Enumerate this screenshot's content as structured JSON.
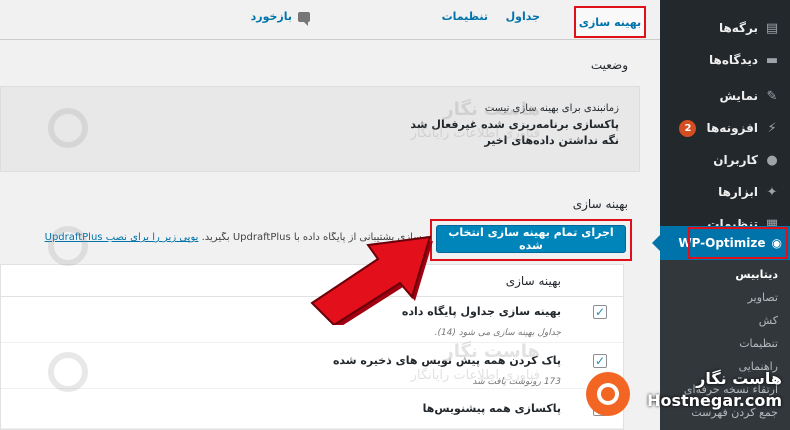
{
  "tabs": {
    "optimize": "بهینه سازی",
    "tables": "جداول",
    "settings": "تنظیمات",
    "feedback": "بازخورد"
  },
  "status": {
    "heading": "وضعیت",
    "lines": [
      "زمانبندی برای بهینه سازی نیست",
      "پاکسازی برنامه‌ریزی شده غیرفعال شد",
      "نگه نداشتن داده‌های اخیر"
    ]
  },
  "optimizations": {
    "heading": "بهینه سازی",
    "hint_text": "ه سازی پشتیبانی از پایگاه داده با UpdraftPlus بگیرید.",
    "hint_link": "یوپی زیر را برای نصب UpdraftPlus",
    "run_all_button": "اجرای تمام بهینه سازی انتخاب شده",
    "table_header": "بهینه سازی",
    "rows": [
      {
        "title": "بهینه سازی جداول پایگاه داده",
        "sub": "جداول بهینه سازی می شود (14)."
      },
      {
        "title": "پاک کردن همه پیش نویس های ذخیره شده",
        "sub": "173 رونوشت یافت شد"
      },
      {
        "title": "پاکسازی همه پیشنویس‌ها",
        "sub": ""
      }
    ]
  },
  "sidebar": {
    "items": [
      {
        "label": "برگه‌ها",
        "icon": "pages-icon"
      },
      {
        "label": "دیدگاه‌ها",
        "icon": "comments-icon"
      },
      {
        "label": "نمایش",
        "icon": "appearance-icon"
      },
      {
        "label": "افزونه‌ها",
        "icon": "plugins-icon",
        "badge": "2"
      },
      {
        "label": "کاربران",
        "icon": "users-icon"
      },
      {
        "label": "ابزارها",
        "icon": "tools-icon"
      },
      {
        "label": "تنظیمات",
        "icon": "settings-icon"
      }
    ],
    "active": "WP-Optimize",
    "submenu": [
      "دیتابیس",
      "تصاویر",
      "کش",
      "تنظیمات",
      "راهنمایی",
      "ارتقاء نسخه حرفه‌ای",
      "جمع کردن فهرست"
    ]
  },
  "watermark": {
    "title": "هاست نگار",
    "subtitle": "فناوری اطلاعات رایانگار"
  },
  "brand": {
    "fa": "هاست نگار",
    "en": "Hostnegar.com"
  }
}
